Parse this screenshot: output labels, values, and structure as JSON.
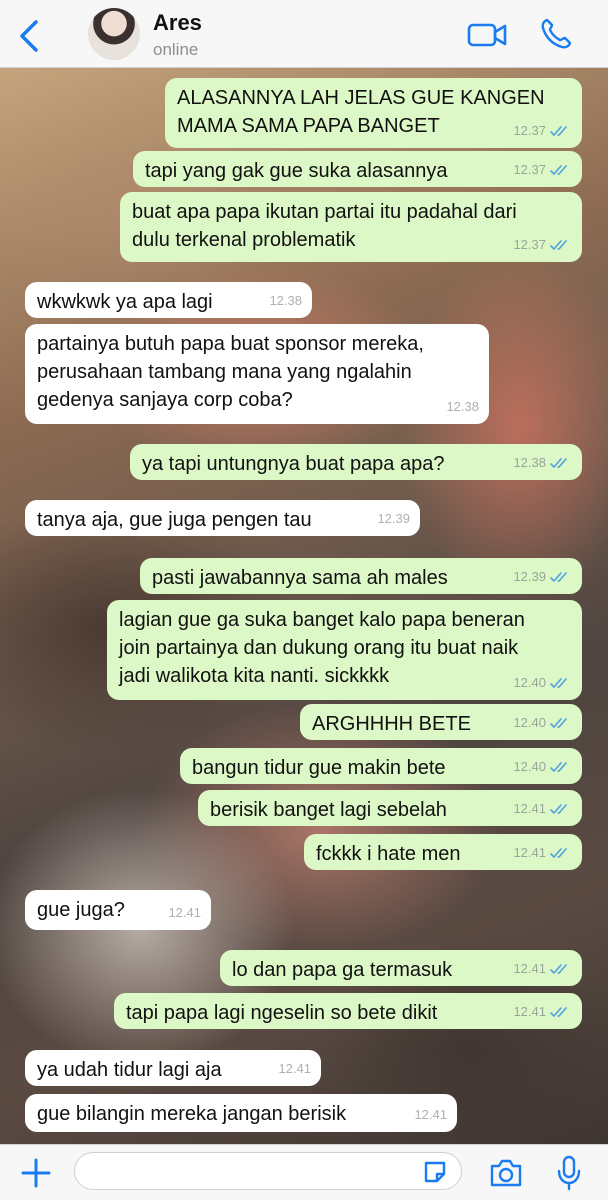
{
  "header": {
    "contact_name": "Ares",
    "status": "online"
  },
  "messages": [
    {
      "dir": "out",
      "text": "ALASANNYA LAH JELAS GUE KANGEN\nMAMA SAMA PAPA BANGET",
      "time": "12.37"
    },
    {
      "dir": "out",
      "text": "tapi yang gak gue suka alasannya",
      "time": "12.37"
    },
    {
      "dir": "out",
      "text": "buat apa papa ikutan partai itu padahal dari\ndulu terkenal problematik",
      "time": "12.37"
    },
    {
      "dir": "in",
      "text": "wkwkwk ya apa lagi",
      "time": "12.38"
    },
    {
      "dir": "in",
      "text": "partainya butuh papa buat sponsor mereka,\nperusahaan tambang mana yang ngalahin\ngedenya sanjaya corp coba?",
      "time": "12.38"
    },
    {
      "dir": "out",
      "text": "ya tapi untungnya buat papa apa?",
      "time": "12.38"
    },
    {
      "dir": "in",
      "text": "tanya aja, gue juga pengen tau",
      "time": "12.39"
    },
    {
      "dir": "out",
      "text": "pasti jawabannya sama ah males",
      "time": "12.39"
    },
    {
      "dir": "out",
      "text": "lagian gue ga suka banget kalo papa beneran\njoin partainya dan dukung orang itu buat naik\njadi walikota kita nanti. sickkkk",
      "time": "12.40"
    },
    {
      "dir": "out",
      "text": "ARGHHHH BETE",
      "time": "12.40"
    },
    {
      "dir": "out",
      "text": "bangun tidur gue makin bete",
      "time": "12.40"
    },
    {
      "dir": "out",
      "text": "berisik banget lagi sebelah",
      "time": "12.41"
    },
    {
      "dir": "out",
      "text": "fckkk i hate men",
      "time": "12.41"
    },
    {
      "dir": "in",
      "text": "gue juga?",
      "time": "12.41"
    },
    {
      "dir": "out",
      "text": "lo dan papa ga termasuk",
      "time": "12.41"
    },
    {
      "dir": "out",
      "text": "tapi papa lagi ngeselin so bete dikit",
      "time": "12.41"
    },
    {
      "dir": "in",
      "text": "ya udah tidur lagi aja",
      "time": "12.41"
    },
    {
      "dir": "in",
      "text": "gue bilangin mereka jangan berisik",
      "time": "12.41"
    }
  ],
  "composer": {
    "input_value": "",
    "input_placeholder": ""
  },
  "icons": {
    "back": "chevron-left-icon",
    "video": "video-camera-icon",
    "phone": "phone-icon",
    "plus": "plus-icon",
    "sticker": "sticker-icon",
    "camera": "camera-icon",
    "mic": "microphone-icon"
  },
  "colors": {
    "accent": "#1a7cf0",
    "outgoing_bubble": "#dcf8c6",
    "incoming_bubble": "#ffffff",
    "read_ticks": "#4fa3e0"
  }
}
